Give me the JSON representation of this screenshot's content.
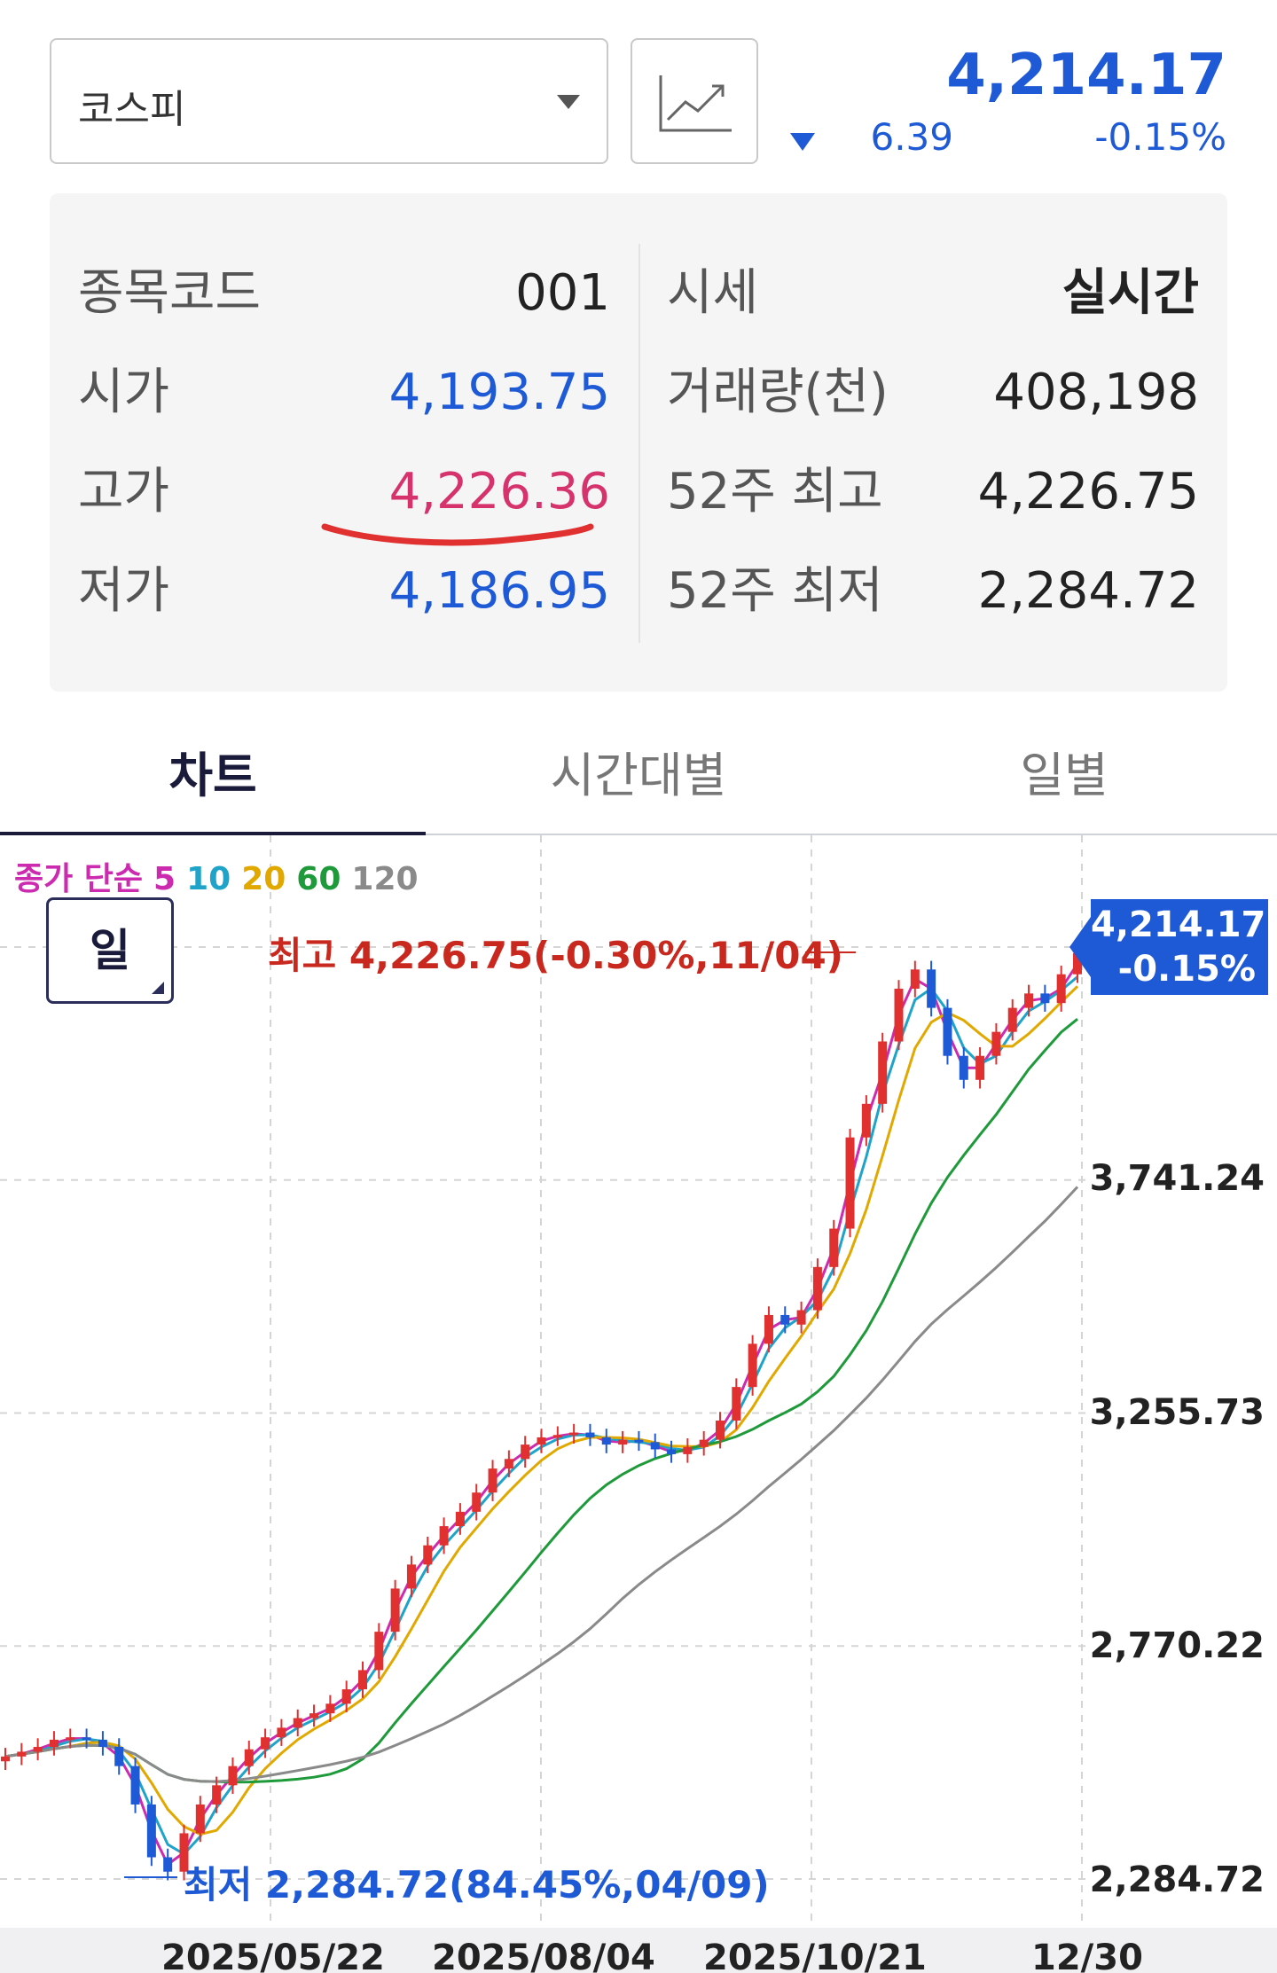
{
  "header": {
    "index_name": "코스피",
    "chart_icon": "line-chart-icon",
    "change_value": "6.39",
    "price": "4,214.17",
    "change_pct": "-0.15%",
    "colors": {
      "down": "#1f5ad6",
      "up": "#d6336c"
    }
  },
  "info": {
    "left": [
      {
        "label": "종목코드",
        "value": "001",
        "color": "dark"
      },
      {
        "label": "시가",
        "value": "4,193.75",
        "color": "blue"
      },
      {
        "label": "고가",
        "value": "4,226.36",
        "color": "red"
      },
      {
        "label": "저가",
        "value": "4,186.95",
        "color": "blue"
      }
    ],
    "right": [
      {
        "label": "시세",
        "value": "실시간"
      },
      {
        "label": "거래량(천)",
        "value": "408,198"
      },
      {
        "label": "52주 최고",
        "value": "4,226.75"
      },
      {
        "label": "52주 최저",
        "value": "2,284.72"
      }
    ]
  },
  "tabs": [
    {
      "label": "차트",
      "active": true
    },
    {
      "label": "시간대별",
      "active": false
    },
    {
      "label": "일별",
      "active": false
    }
  ],
  "chart": {
    "ma_legend": {
      "prefix": "종가 단순",
      "items": [
        {
          "label": "5",
          "color": "#cc2bb0"
        },
        {
          "label": "10",
          "color": "#1fa3c9"
        },
        {
          "label": "20",
          "color": "#e1a900"
        },
        {
          "label": "60",
          "color": "#1e9a3a"
        },
        {
          "label": "120",
          "color": "#8a8a8a"
        }
      ]
    },
    "period_button": "일",
    "current_price_tag": {
      "price": "4,214.17",
      "pct": "-0.15%"
    },
    "high_annotation": "최고 4,226.75(-0.30%,11/04)",
    "low_annotation": "최저 2,284.72(84.45%,04/09)",
    "y_ticks": [
      "3,741.24",
      "3,255.73",
      "2,770.22",
      "2,284.72"
    ],
    "x_ticks": [
      "2025/05/22",
      "2025/08/04",
      "2025/10/21",
      "12/30"
    ]
  },
  "chart_data": {
    "type": "candlestick",
    "ylim": [
      2284.72,
      4226.75
    ],
    "y_ticks": [
      2284.72,
      2770.22,
      3255.73,
      3741.24
    ],
    "x_ticks": [
      "2025/05/22",
      "2025/08/04",
      "2025/10/21",
      "12/30"
    ],
    "series": [
      {
        "name": "5",
        "color": "#cc2bb0"
      },
      {
        "name": "10",
        "color": "#1fa3c9"
      },
      {
        "name": "20",
        "color": "#e1a900"
      },
      {
        "name": "60",
        "color": "#1e9a3a"
      },
      {
        "name": "120",
        "color": "#8a8a8a"
      }
    ],
    "close_approx": [
      2540,
      2550,
      2560,
      2575,
      2580,
      2575,
      2560,
      2520,
      2440,
      2330,
      2300,
      2380,
      2440,
      2480,
      2520,
      2555,
      2580,
      2600,
      2620,
      2630,
      2650,
      2680,
      2720,
      2800,
      2890,
      2940,
      2980,
      3020,
      3050,
      3090,
      3140,
      3160,
      3190,
      3205,
      3210,
      3215,
      3205,
      3190,
      3200,
      3195,
      3180,
      3170,
      3185,
      3200,
      3240,
      3310,
      3400,
      3460,
      3440,
      3470,
      3560,
      3640,
      3830,
      3900,
      4030,
      4140,
      4180,
      4100,
      4000,
      3950,
      4000,
      4050,
      4100,
      4130,
      4110,
      4170,
      4214.17
    ],
    "high": {
      "value": 4226.75,
      "label": "최고 4,226.75(-0.30%,11/04)"
    },
    "low": {
      "value": 2284.72,
      "label": "최저 2,284.72(84.45%,04/09)"
    }
  }
}
